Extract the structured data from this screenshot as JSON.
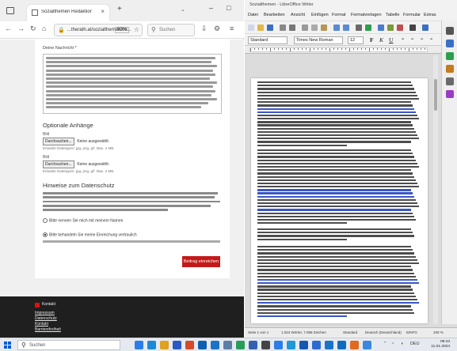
{
  "browser": {
    "tab_title": "Sozialthemen Redaktion",
    "url": "...therath.at/sozialthemen/08...",
    "zoom": "90%",
    "search_placeholder": "Suchen"
  },
  "form": {
    "message_label": "Deine Nachricht *",
    "attachments_title": "Optionale Anhänge",
    "file1_label": "Bild",
    "file2_label": "Bild",
    "file_button": "Durchsuchen...",
    "file_none": "Keine ausgewählt.",
    "file_hint": "Erlaubte Dateitypen: jpg, png, gif. Max. 2 MB.",
    "names_title": "Hinweise zum Datenschutz",
    "radio1": "Bitte nennen Sie mich mit meinem Namen",
    "radio2": "Bitte behandeln Sie meine Einreichung vertraulich",
    "submit": "Beitrag einreichen"
  },
  "footer": {
    "brand": "Kontakt",
    "links": [
      "Impressum",
      "Datenschutz",
      "Kontakt",
      "Barrierefreiheit"
    ]
  },
  "writer": {
    "title": "Sozialthemen - LibreOffice Writer",
    "menu": [
      "Datei",
      "Bearbeiten",
      "Ansicht",
      "Einfügen",
      "Format",
      "Formatvorlagen",
      "Tabelle",
      "Formular",
      "Extras",
      "Fenster",
      "Hilfe"
    ],
    "paragraph_style": "Standard",
    "font_name": "Times New Roman",
    "font_size": "12",
    "bold": "F",
    "italic": "K",
    "underline": "U",
    "statusbar": {
      "page": "Seite 1 von 1",
      "words": "1.024 Wörter, 7.058 Zeichen",
      "style": "Standard",
      "language": "Deutsch (Deutschland)",
      "mode": "EINFG",
      "zoom": "100 %"
    }
  },
  "taskbar": {
    "search_placeholder": "Suchen",
    "tray_lang": "DEU",
    "time": "09:43",
    "date": "11.01.2024"
  }
}
